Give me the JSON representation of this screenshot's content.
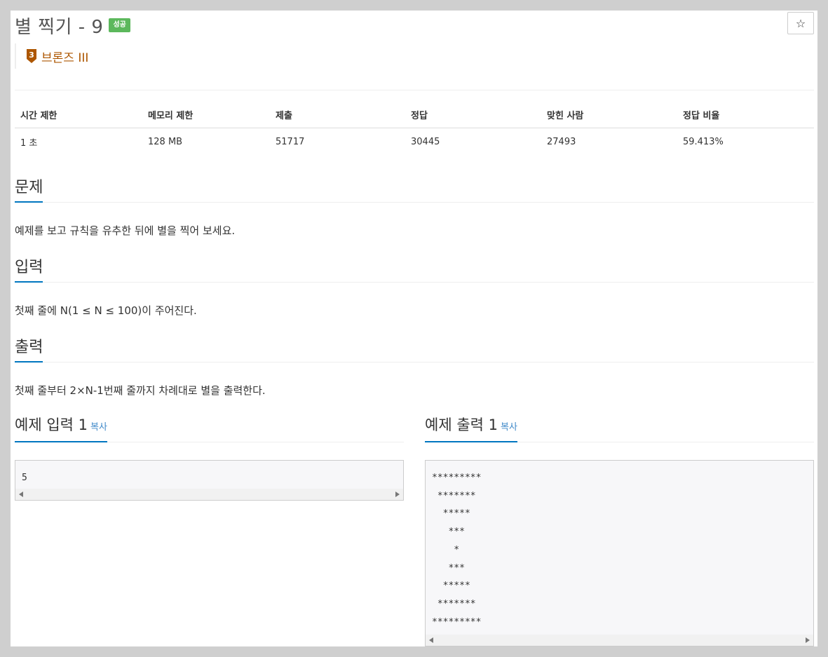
{
  "problem": {
    "title": "별 찍기 - 9",
    "status_badge": "성공",
    "star_button": "☆",
    "tier": {
      "number": "3",
      "label": "브론즈 III",
      "color": "#ad5600"
    }
  },
  "info_table": {
    "headers": [
      "시간 제한",
      "메모리 제한",
      "제출",
      "정답",
      "맞힌 사람",
      "정답 비율"
    ],
    "values": [
      "1 초",
      "128 MB",
      "51717",
      "30445",
      "27493",
      "59.413%"
    ]
  },
  "sections": {
    "problem": {
      "title": "문제",
      "body": "예제를 보고 규칙을 유추한 뒤에 별을 찍어 보세요."
    },
    "input": {
      "title": "입력",
      "body": "첫째 줄에 N(1 ≤ N ≤ 100)이 주어진다."
    },
    "output": {
      "title": "출력",
      "body": "첫째 줄부터 2×N-1번째 줄까지 차례대로 별을 출력한다."
    }
  },
  "samples": {
    "input": {
      "title": "예제 입력 1",
      "copy_label": "복사",
      "content": "5"
    },
    "output": {
      "title": "예제 출력 1",
      "copy_label": "복사",
      "content": "*********\n *******\n  *****\n   ***\n    *\n   ***\n  *****\n *******\n*********"
    }
  },
  "colors": {
    "accent": "#0076c0",
    "success": "#5cb85c",
    "link": "#428bca",
    "bronze": "#ad5600"
  }
}
